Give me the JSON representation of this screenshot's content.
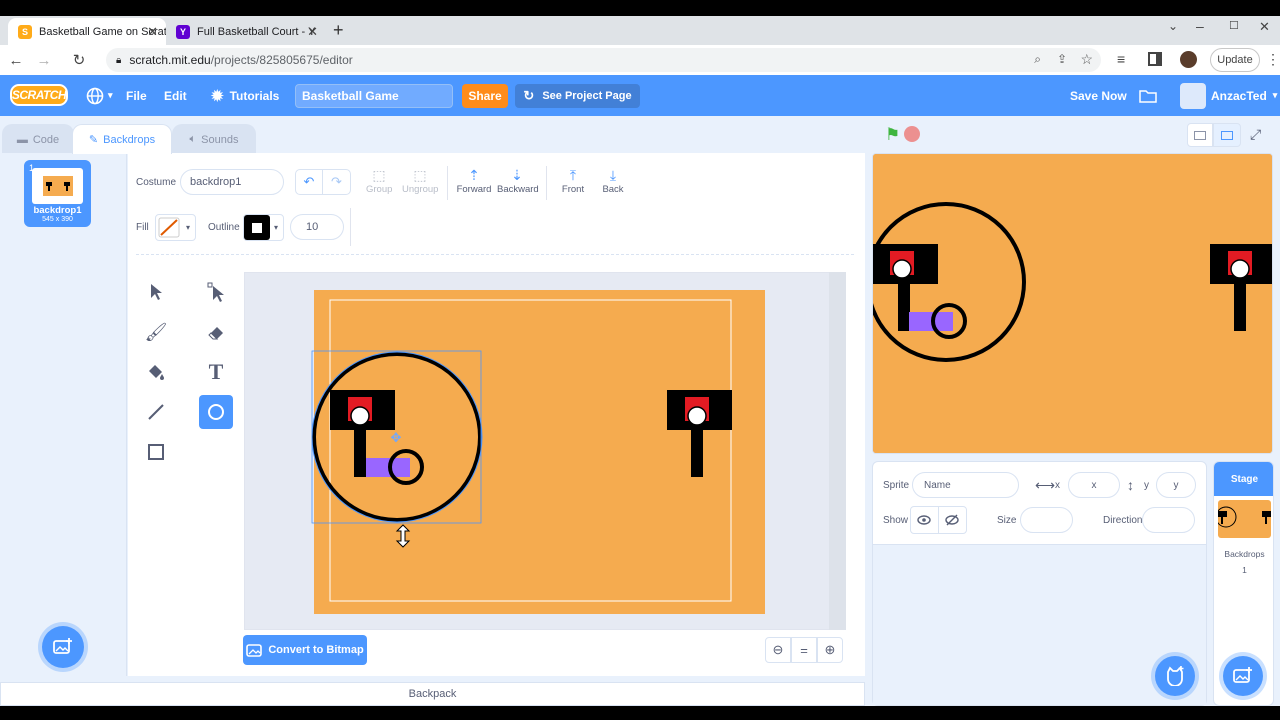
{
  "browser": {
    "tabs": [
      {
        "title": "Basketball Game on Scratch"
      },
      {
        "title": "Full Basketball Court - Yahoo I"
      }
    ],
    "url_host": "scratch.mit.edu",
    "url_path": "/projects/825805675/editor",
    "update_label": "Update"
  },
  "menu": {
    "logo": "SCRATCH",
    "file": "File",
    "edit": "Edit",
    "tutorials": "Tutorials",
    "project_title": "Basketball Game",
    "share": "Share",
    "see_project_page": "See Project Page",
    "save_now": "Save Now",
    "username": "AnzacTed"
  },
  "editor_tabs": {
    "code": "Code",
    "backdrops": "Backdrops",
    "sounds": "Sounds"
  },
  "costume_list": [
    {
      "index": "1",
      "name": "backdrop1",
      "size": "545 x 390"
    }
  ],
  "paint": {
    "costume_label": "Costume",
    "costume_name": "backdrop1",
    "group": "Group",
    "ungroup": "Ungroup",
    "forward": "Forward",
    "backward": "Backward",
    "front": "Front",
    "back": "Back",
    "fill_label": "Fill",
    "outline_label": "Outline",
    "outline_width": "10",
    "convert": "Convert to Bitmap",
    "zoom_reset": "="
  },
  "backpack": "Backpack",
  "sprite_info": {
    "sprite_label": "Sprite",
    "name_placeholder": "Name",
    "x_label": "x",
    "x_placeholder": "x",
    "y_label": "y",
    "y_placeholder": "y",
    "show_label": "Show",
    "size_label": "Size",
    "direction_label": "Direction"
  },
  "stage_panel": {
    "title": "Stage",
    "backdrops_label": "Backdrops",
    "backdrops_count": "1"
  },
  "colors": {
    "scratch_blue": "#4c97ff",
    "court_orange": "#f5ab4f",
    "share_orange": "#ff8c1a",
    "hoop_red": "#e31b23",
    "paddle_purple": "#9966ff"
  }
}
